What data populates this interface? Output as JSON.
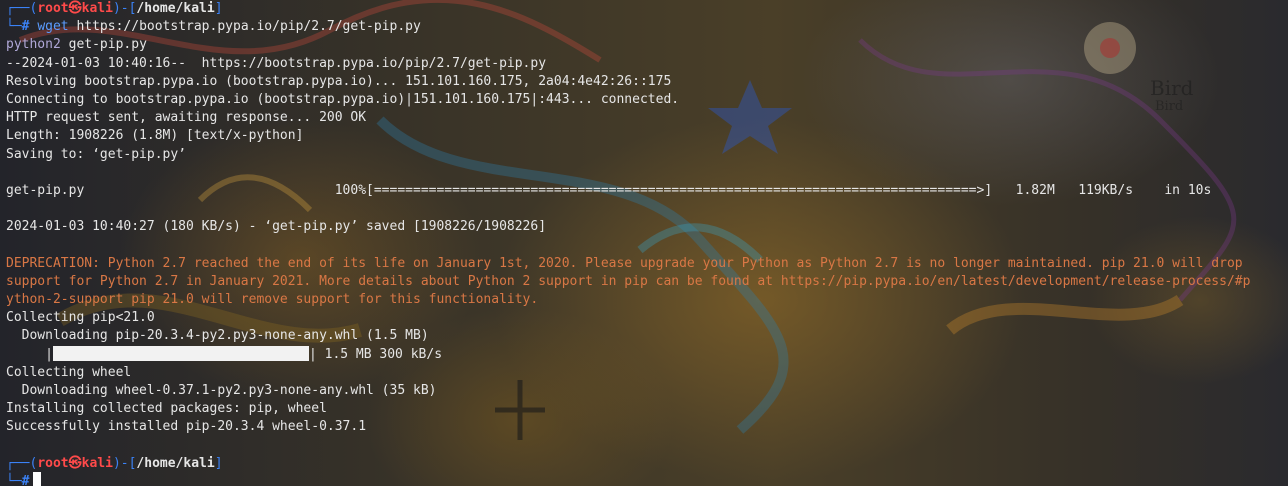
{
  "prompt1": {
    "box_top": "┌──(",
    "user": "root㉿kali",
    "mid": ")-[",
    "cwd": "/home/kali",
    "close": "]",
    "box_bottom": "└─",
    "hash": "#",
    "cmd_name": "wget",
    "cmd_args": "https://bootstrap.pypa.io/pip/2.7/get-pip.py"
  },
  "output": {
    "l1_a": "python2",
    "l1_b": "get-pip.py",
    "l2": "--2024-01-03 10:40:16--  https://bootstrap.pypa.io/pip/2.7/get-pip.py",
    "l3": "Resolving bootstrap.pypa.io (bootstrap.pypa.io)... 151.101.160.175, 2a04:4e42:26::175",
    "l4": "Connecting to bootstrap.pypa.io (bootstrap.pypa.io)|151.101.160.175|:443... connected.",
    "l5": "HTTP request sent, awaiting response... 200 OK",
    "l6": "Length: 1908226 (1.8M) [text/x-python]",
    "l7": "Saving to: ‘get-pip.py’",
    "dl_line": "get-pip.py                                100%[=============================================================================>]   1.82M   119KB/s    in 10s",
    "saved": "2024-01-03 10:40:27 (180 KB/s) - ‘get-pip.py’ saved [1908226/1908226]",
    "dep1": "DEPRECATION: Python 2.7 reached the end of its life on January 1st, 2020. Please upgrade your Python as Python 2.7 is no longer maintained. pip 21.0 will drop",
    "dep2": "support for Python 2.7 in January 2021. More details about Python 2 support in pip can be found at https://pip.pypa.io/en/latest/development/release-process/#p",
    "dep3": "ython-2-support pip 21.0 will remove support for this functionality.",
    "c1": "Collecting pip<21.0",
    "c2": "  Downloading pip-20.3.4-py2.py3-none-any.whl (1.5 MB)",
    "pbar_left": "     |",
    "pbar_right": "| 1.5 MB 300 kB/s",
    "c3": "Collecting wheel",
    "c4": "  Downloading wheel-0.37.1-py2.py3-none-any.whl (35 kB)",
    "c5": "Installing collected packages: pip, wheel",
    "c6": "Successfully installed pip-20.3.4 wheel-0.37.1"
  },
  "prompt2": {
    "box_top": "┌──(",
    "user": "root㉿kali",
    "mid": ")-[",
    "cwd": "/home/kali",
    "close": "]",
    "box_bottom": "└─",
    "hash": "#"
  },
  "pip_download_progress": 1.0,
  "wallpaper_text": [
    "Bird",
    "Bird"
  ],
  "colors": {
    "prompt_frame": "#3b82f6",
    "prompt_user": "#ff4a4a",
    "warning": "#d97745",
    "text": "#e6e6e6"
  }
}
